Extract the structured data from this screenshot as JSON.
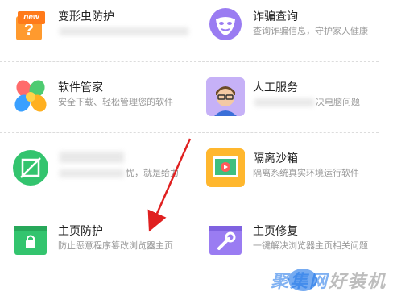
{
  "items": [
    {
      "id": "morph-bug",
      "title": "变形虫防护",
      "desc": "",
      "badge": "new",
      "icon": "shield-question-icon",
      "color": "#ff8c1a"
    },
    {
      "id": "fraud-check",
      "title": "诈骗查询",
      "desc": "查询诈骗信息，守护家人健康",
      "icon": "mask-icon",
      "color": "#8c6cf0"
    },
    {
      "id": "software-manager",
      "title": "软件管家",
      "desc": "安全下载、轻松管理您的软件",
      "icon": "flower-icon",
      "color": "#ff5a5a"
    },
    {
      "id": "human-service",
      "title": "人工服务",
      "desc": "决电脑问题",
      "icon": "person-icon",
      "color": "#b99cf5"
    },
    {
      "id": "blurred-tool",
      "title": "",
      "desc": "忧，就是给力",
      "icon": "slash-circle-icon",
      "color": "#2ec46a"
    },
    {
      "id": "sandbox",
      "title": "隔离沙箱",
      "desc": "隔离系统真实环境运行软件",
      "icon": "sandbox-icon",
      "color": "#ffb020"
    },
    {
      "id": "home-protect",
      "title": "主页防护",
      "desc": "防止恶意程序篡改浏览器主页",
      "icon": "lock-window-icon",
      "color": "#2ec46a"
    },
    {
      "id": "home-repair",
      "title": "主页修复",
      "desc": "一键解决浏览器主页相关问题",
      "icon": "wrench-window-icon",
      "color": "#8c6cf0"
    }
  ],
  "watermark": {
    "text": "聚集网",
    "suffix": "好装机"
  }
}
